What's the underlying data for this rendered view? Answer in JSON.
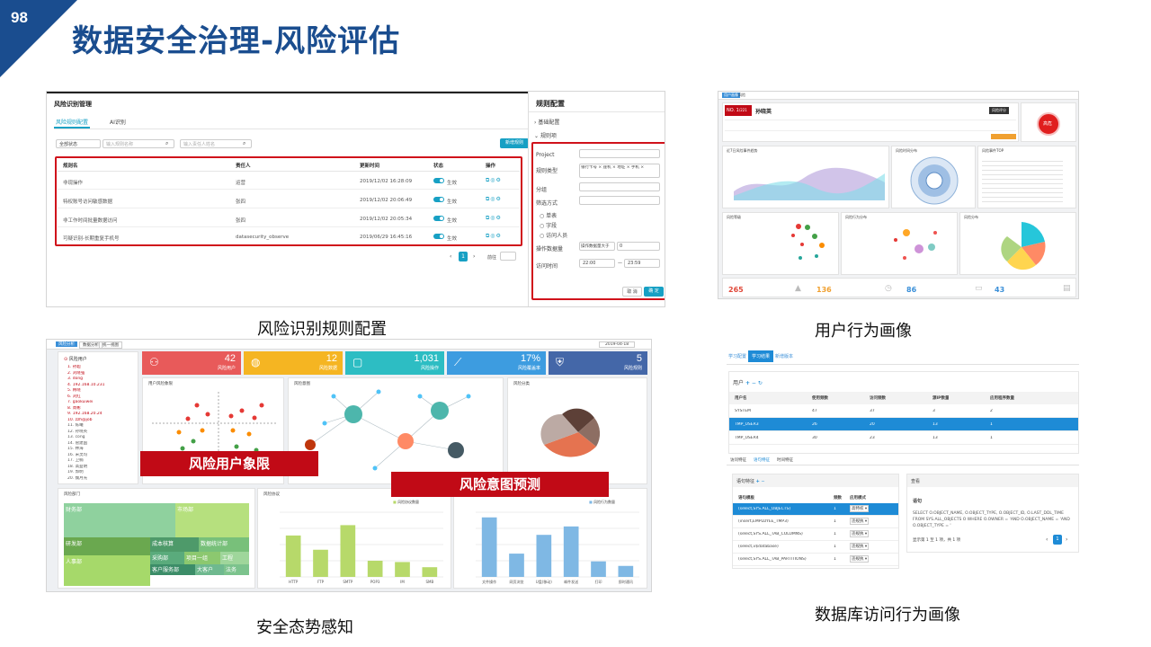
{
  "page": {
    "number": "98",
    "title": "数据安全治理-风险评估",
    "brand_color": "#1a4d8f",
    "accent_red": "#c10a16"
  },
  "captions": {
    "rule_config": "风险识别规则配置",
    "user_profile": "用户行为画像",
    "situation": "安全态势感知",
    "db_profile": "数据库访问行为画像"
  },
  "rule_config": {
    "module_title": "风险识别管理",
    "tabs": [
      "风险规则配置",
      "AI识别"
    ],
    "filter_status": "全部状态",
    "filter_name_placeholder": "输入规则名称",
    "filter_person_placeholder": "输入责任人姓名",
    "new_button": "新增规则",
    "columns": [
      "规则名",
      "责任人",
      "更新时间",
      "状态",
      "操作"
    ],
    "rows": [
      {
        "name": "非现操作",
        "owner": "运营",
        "time": "2019/12/02 16:28:09",
        "status": "生效"
      },
      {
        "name": "特权账号访问敏感数据",
        "owner": "张四",
        "time": "2019/12/02 20:06:49",
        "status": "生效"
      },
      {
        "name": "非工作时间批量数据访问",
        "owner": "张四",
        "time": "2019/12/02 20:05:34",
        "status": "生效"
      },
      {
        "name": "可疑识别-长期重复手机号",
        "owner": "datasecurity_observe",
        "time": "2019/06/29 16:45:16",
        "status": "生效"
      }
    ],
    "pagination": {
      "current": "1",
      "goto_label": "前往"
    },
    "side": {
      "title": "规则配置",
      "section_basic": "基础配置",
      "section_rules": "规则项",
      "fields": [
        {
          "label": "Project",
          "value": ""
        },
        {
          "label": "规则类型",
          "value": "银行卡号 × 座机 × 地址 ×  手机 ×"
        },
        {
          "label": "分组",
          "value": ""
        },
        {
          "label": "筛选方式",
          "value": ""
        }
      ],
      "radios": [
        "单表",
        "字段",
        "访问人员"
      ],
      "count_label": "操作数据量",
      "count_op": "操作数据量大于",
      "count_value": "0",
      "time_label": "访问时间",
      "time_from": "22:00",
      "time_to": "23:59",
      "cancel": "取 消",
      "confirm": "确 定"
    }
  },
  "user_profile": {
    "tab_labels": [
      "用户画像",
      "风险"
    ],
    "id_badge": "NO. 1",
    "id_sub": "/221",
    "user_name": "孙晓英",
    "risk_badge": "风险评分",
    "risk_label": "高危",
    "chart_titles": [
      "近7日风险事件趋势",
      "风险时间分布",
      "风险事件TOP",
      "风险等级",
      "风险行为分布",
      "风险分布"
    ],
    "kpis": [
      {
        "value": "265",
        "color": "#e0493a"
      },
      {
        "value": "136",
        "color": "#f0a030"
      },
      {
        "value": "86",
        "color": "#3a8fd8"
      },
      {
        "value": "43",
        "color": "#3a8fd8"
      }
    ]
  },
  "situation": {
    "top_tabs": [
      "风险分析",
      "数据分析",
      "统一视图"
    ],
    "date": "2019-04-18",
    "stats": [
      {
        "value": "42",
        "label": "风险用户",
        "color": "#e85a5a"
      },
      {
        "value": "12",
        "label": "风险数据",
        "color": "#f5b522"
      },
      {
        "value": "1,031",
        "label": "风险操作",
        "color": "#2dbdc3"
      },
      {
        "value": "17%",
        "label": "风险覆盖率",
        "color": "#3d9ce0"
      },
      {
        "value": "5",
        "label": "风险规则",
        "color": "#4467a8"
      }
    ],
    "risk_user_title": "风险用户",
    "risk_users": [
      "1. 孙超",
      "2. 刘晓强",
      "3. dong",
      "4. 192.168.10.231",
      "5. 韩晓",
      "6. 刘红",
      "7. gaokuiwei",
      "8. 周彬",
      "9. 192.168.20.24",
      "10. zzh@job",
      "11. 陈曦",
      "12. 孙晓英",
      "13. cong",
      "14. 管建国",
      "15. 林海",
      "16. 宋灵均",
      "17. 卫楠",
      "18. 高益明",
      "19. 郭明",
      "20. 魏月光"
    ],
    "panel_titles": [
      "用户风险象限",
      "风险意图",
      "风险分类",
      "风险部门",
      "风险协议",
      "风险量"
    ],
    "label_quadrant": "风险用户象限",
    "label_intent": "风险意图预测",
    "treemap": [
      "财务部",
      "市场部",
      "研发部",
      "成本核算",
      "数据统计部",
      "采购部",
      "项目一组",
      "工程",
      "人事部",
      "客户服务部",
      "大客户",
      "法务"
    ],
    "protocol_legend": "风险协议数量",
    "protocol_bars": [
      {
        "name": "HTTP",
        "value": 640
      },
      {
        "name": "FTP",
        "value": 420
      },
      {
        "name": "SMTP",
        "value": 800
      },
      {
        "name": "POP3",
        "value": 250
      },
      {
        "name": "IM",
        "value": 230
      },
      {
        "name": "SMB",
        "value": 150
      }
    ],
    "volume_legend": "风险行为数量",
    "volume_bars": [
      {
        "name": "文件操作",
        "value": 920
      },
      {
        "name": "网页浏览",
        "value": 360
      },
      {
        "name": "U盘(移动)",
        "value": 650
      },
      {
        "name": "邮件发送",
        "value": 780
      },
      {
        "name": "打印",
        "value": 240
      },
      {
        "name": "即时通讯",
        "value": 170
      }
    ]
  },
  "db_profile": {
    "tabs": [
      "学习配置",
      "学习结果",
      "新增版本"
    ],
    "user_label": "用户",
    "columns": [
      "用户名",
      "使用频数",
      "访问频数",
      "源IP数量",
      "应用程序数量"
    ],
    "rows": [
      {
        "c": [
          "SYSTEM",
          "47",
          "37",
          "3",
          "2"
        ],
        "selected": false
      },
      {
        "c": [
          "TMP_USER3",
          "26",
          "20",
          "13",
          "1"
        ],
        "selected": true
      },
      {
        "c": [
          "TMP_USER4",
          "30",
          "23",
          "13",
          "1"
        ],
        "selected": false
      }
    ],
    "subtabs": [
      "访问特征",
      "语句特征",
      "时间特征"
    ],
    "sql_panel_title": "语句特征",
    "sql_columns": [
      "语句模板",
      "频数",
      "应用模式"
    ],
    "sql_rows": [
      {
        "c": [
          "(select,SYS.ALL_OBJECTS)",
          "1",
          "高特权 ▾"
        ],
        "selected": true
      },
      {
        "c": [
          "(insert,EMPLOYEE_TMP3)",
          "1",
          "违规执 ▾"
        ],
        "selected": false
      },
      {
        "c": [
          "(select,SYS.ALL_TAB_COLUMNS)",
          "1",
          "违规执 ▾"
        ],
        "selected": false
      },
      {
        "c": [
          "(select,v$database)",
          "1",
          "违规执 ▾"
        ],
        "selected": false
      },
      {
        "c": [
          "(select,SYS.ALL_TAB_PARTITIONS)",
          "1",
          "违规执 ▾"
        ],
        "selected": false
      }
    ],
    "detail_title": "查看",
    "detail_label": "语句",
    "detail_sql": "SELECT O.OBJECT_NAME, O.OBJECT_TYPE, O.OBJECT_ID, O.LAST_DDL_TIME FROM SYS.ALL_OBJECTS O WHERE O.OWNER = 'AND O.OBJECT_NAME = 'AND O.OBJECT_TYPE = '",
    "detail_footer": "显示第 1 至 1 项，共 1 项",
    "page_current": "1"
  }
}
